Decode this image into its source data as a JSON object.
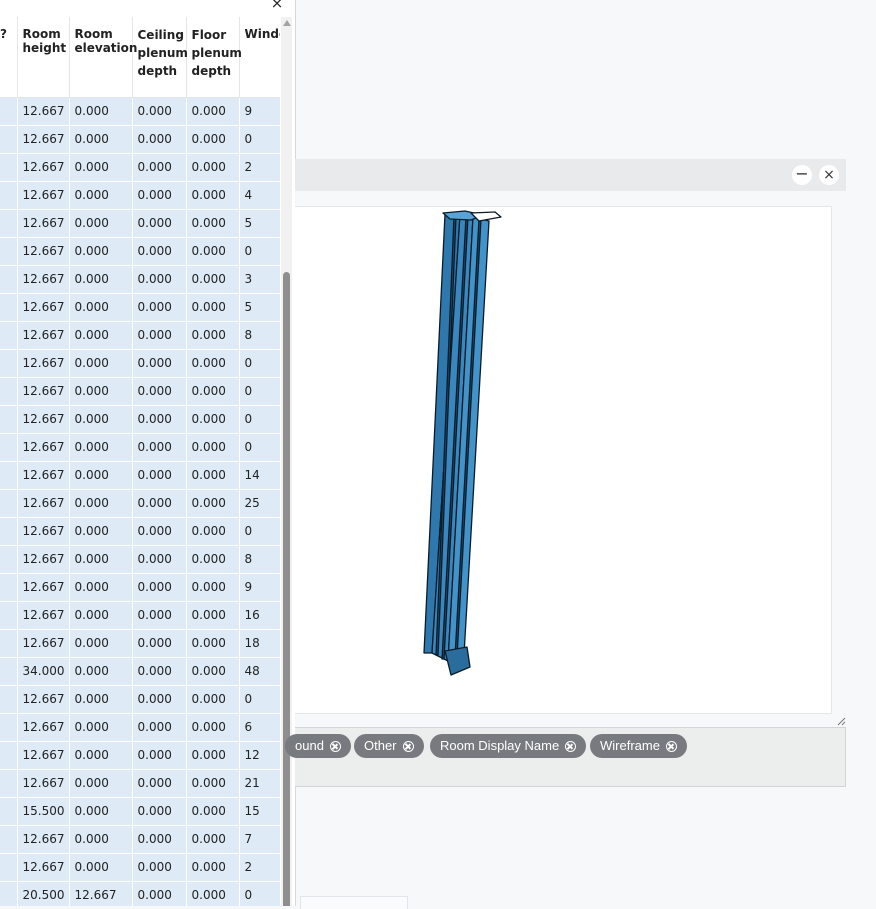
{
  "table": {
    "columns": [
      "?",
      "Room height",
      "Room elevation",
      "Ceiling plenum depth",
      "Floor plenum depth",
      "Windo"
    ],
    "rows": [
      [
        "12.667",
        "0.000",
        "0.000",
        "0.000",
        "9"
      ],
      [
        "12.667",
        "0.000",
        "0.000",
        "0.000",
        "0"
      ],
      [
        "12.667",
        "0.000",
        "0.000",
        "0.000",
        "2"
      ],
      [
        "12.667",
        "0.000",
        "0.000",
        "0.000",
        "4"
      ],
      [
        "12.667",
        "0.000",
        "0.000",
        "0.000",
        "5"
      ],
      [
        "12.667",
        "0.000",
        "0.000",
        "0.000",
        "0"
      ],
      [
        "12.667",
        "0.000",
        "0.000",
        "0.000",
        "3"
      ],
      [
        "12.667",
        "0.000",
        "0.000",
        "0.000",
        "5"
      ],
      [
        "12.667",
        "0.000",
        "0.000",
        "0.000",
        "8"
      ],
      [
        "12.667",
        "0.000",
        "0.000",
        "0.000",
        "0"
      ],
      [
        "12.667",
        "0.000",
        "0.000",
        "0.000",
        "0"
      ],
      [
        "12.667",
        "0.000",
        "0.000",
        "0.000",
        "0"
      ],
      [
        "12.667",
        "0.000",
        "0.000",
        "0.000",
        "0"
      ],
      [
        "12.667",
        "0.000",
        "0.000",
        "0.000",
        "14"
      ],
      [
        "12.667",
        "0.000",
        "0.000",
        "0.000",
        "25"
      ],
      [
        "12.667",
        "0.000",
        "0.000",
        "0.000",
        "0"
      ],
      [
        "12.667",
        "0.000",
        "0.000",
        "0.000",
        "8"
      ],
      [
        "12.667",
        "0.000",
        "0.000",
        "0.000",
        "9"
      ],
      [
        "12.667",
        "0.000",
        "0.000",
        "0.000",
        "16"
      ],
      [
        "12.667",
        "0.000",
        "0.000",
        "0.000",
        "18"
      ],
      [
        "34.000",
        "0.000",
        "0.000",
        "0.000",
        "48"
      ],
      [
        "12.667",
        "0.000",
        "0.000",
        "0.000",
        "0"
      ],
      [
        "12.667",
        "0.000",
        "0.000",
        "0.000",
        "6"
      ],
      [
        "12.667",
        "0.000",
        "0.000",
        "0.000",
        "12"
      ],
      [
        "12.667",
        "0.000",
        "0.000",
        "0.000",
        "21"
      ],
      [
        "15.500",
        "0.000",
        "0.000",
        "0.000",
        "15"
      ],
      [
        "12.667",
        "0.000",
        "0.000",
        "0.000",
        "7"
      ],
      [
        "12.667",
        "0.000",
        "0.000",
        "0.000",
        "2"
      ],
      [
        "20.500",
        "12.667",
        "0.000",
        "0.000",
        "0"
      ]
    ]
  },
  "panel": {
    "close_icon": "×"
  },
  "view": {
    "minimize_icon": "−",
    "close_icon": "×",
    "model_fill_color": "#3a87bf"
  },
  "filters": [
    "ound",
    "Other",
    "Room Display Name",
    "Wireframe"
  ]
}
